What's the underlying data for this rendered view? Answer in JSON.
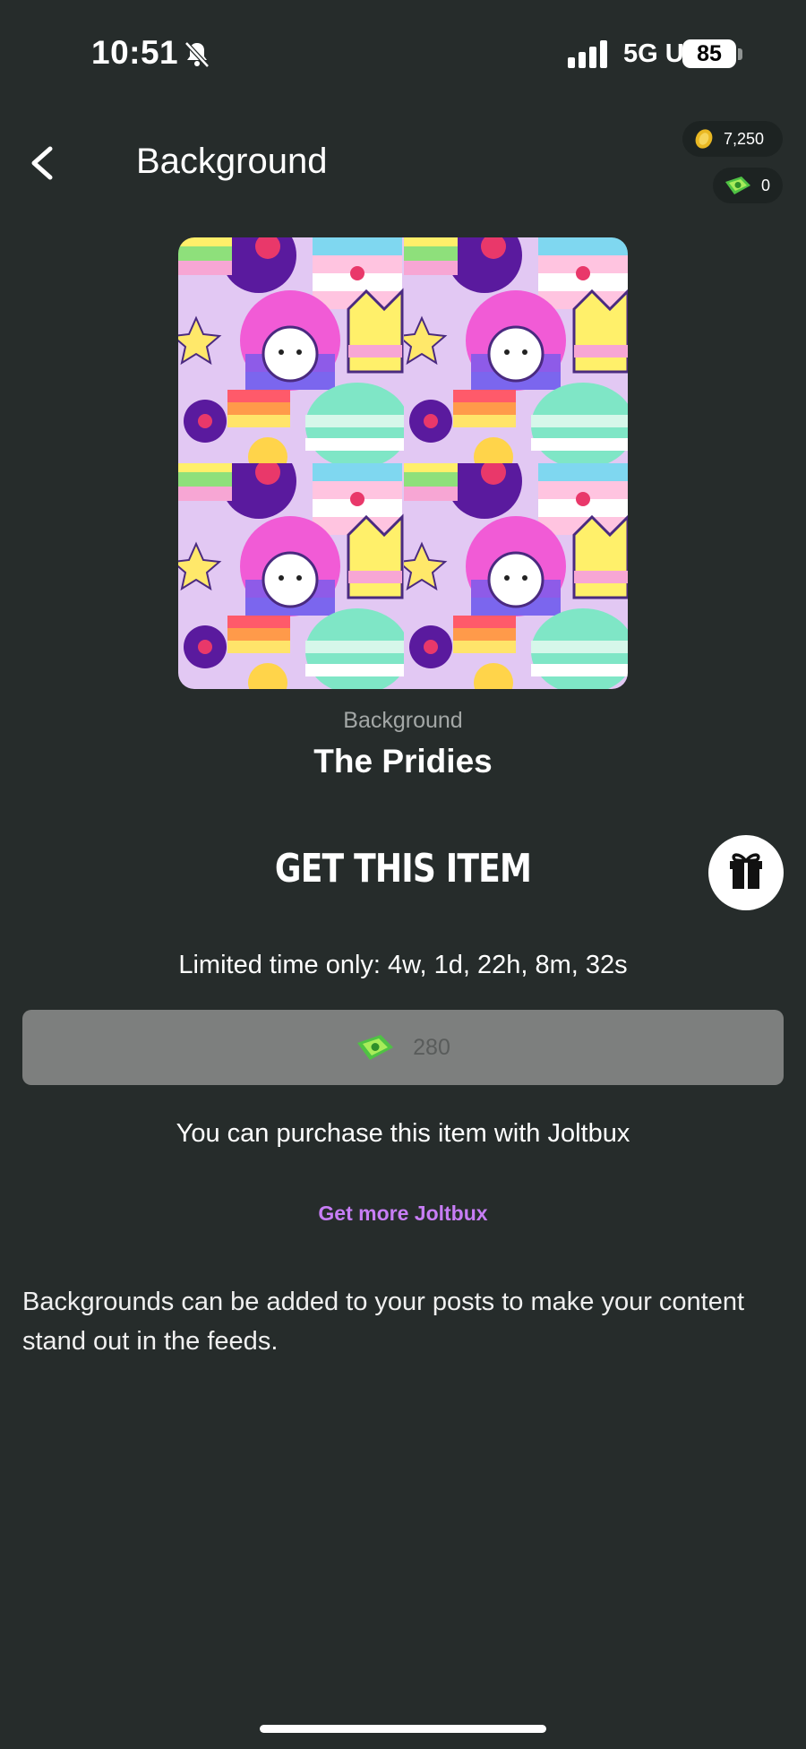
{
  "status_bar": {
    "time": "10:51",
    "network": "5G UC",
    "battery": "85"
  },
  "header": {
    "title": "Background"
  },
  "balance": {
    "coins": "7,250",
    "joltbux": "0"
  },
  "item": {
    "category": "Background",
    "name": "The Pridies"
  },
  "purchase": {
    "heading": "GET THIS ITEM",
    "limited_time": "Limited time only: 4w, 1d, 22h, 8m, 32s",
    "price": "280",
    "note": "You can purchase this item with Joltbux",
    "get_more": "Get more Joltbux"
  },
  "description": "Backgrounds can be added to your posts to make your content stand out in the feeds.",
  "icons": {
    "bell": "bell-slash-icon",
    "signal": "signal-icon",
    "back": "chevron-left-icon",
    "coin": "coin-icon",
    "joltbux": "joltbux-icon",
    "gift": "gift-icon"
  },
  "colors": {
    "background": "#262c2b",
    "accent_link": "#c77df5",
    "button_disabled": "#7d7f7e"
  }
}
